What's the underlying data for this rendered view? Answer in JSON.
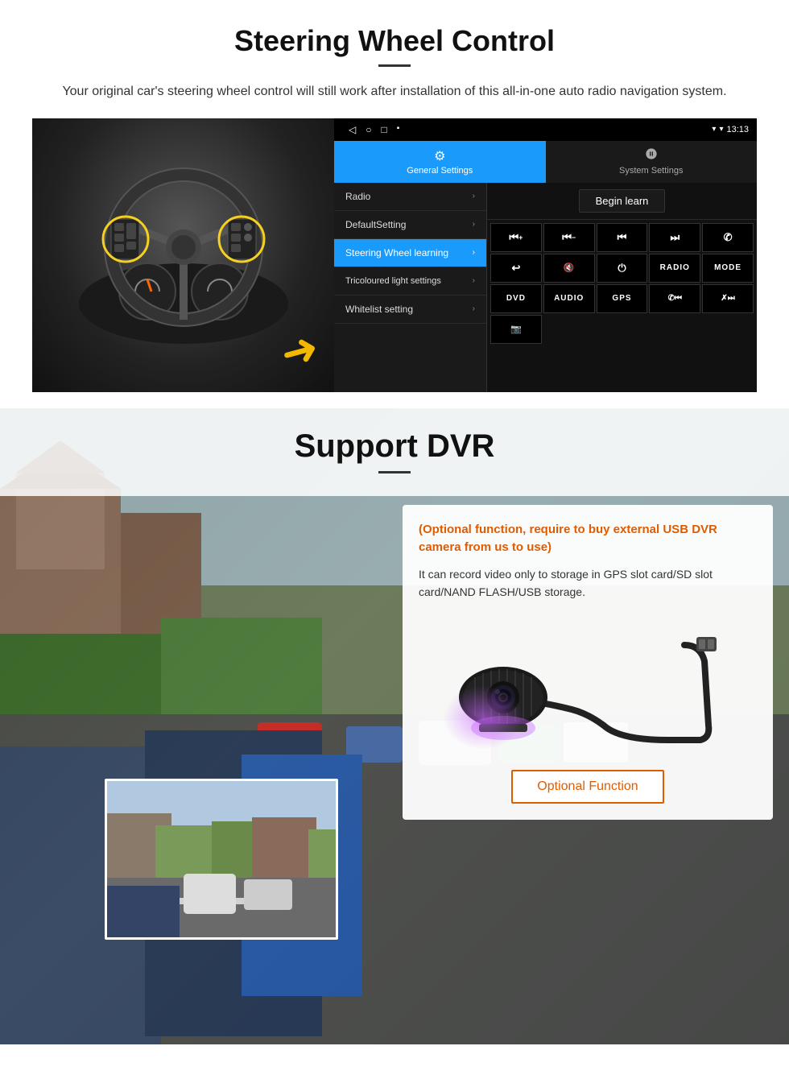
{
  "steering": {
    "title": "Steering Wheel Control",
    "description": "Your original car's steering wheel control will still work after installation of this all-in-one auto radio navigation system.",
    "statusbar": {
      "time": "13:13",
      "signal_icon": "▼",
      "wifi_icon": "▾"
    },
    "tabs": [
      {
        "label": "General Settings",
        "icon": "⚙",
        "active": true
      },
      {
        "label": "System Settings",
        "icon": "⚙",
        "active": false
      }
    ],
    "menu_items": [
      {
        "label": "Radio",
        "active": false
      },
      {
        "label": "DefaultSetting",
        "active": false
      },
      {
        "label": "Steering Wheel learning",
        "active": true
      },
      {
        "label": "Tricoloured light settings",
        "active": false
      },
      {
        "label": "Whitelist setting",
        "active": false
      }
    ],
    "begin_learn_label": "Begin learn",
    "control_buttons": [
      "⏮+",
      "⏮−",
      "⏮⏮",
      "⏭⏭",
      "✆",
      "↩",
      "🔇",
      "⏻",
      "RADIO",
      "MODE",
      "DVD",
      "AUDIO",
      "GPS",
      "✆⏮",
      "✗⏭",
      "📷"
    ]
  },
  "dvr": {
    "title": "Support DVR",
    "card_title": "(Optional function, require to buy external USB DVR camera from us to use)",
    "card_text": "It can record video only to storage in GPS slot card/SD slot card/NAND FLASH/USB storage.",
    "optional_btn_label": "Optional Function"
  }
}
